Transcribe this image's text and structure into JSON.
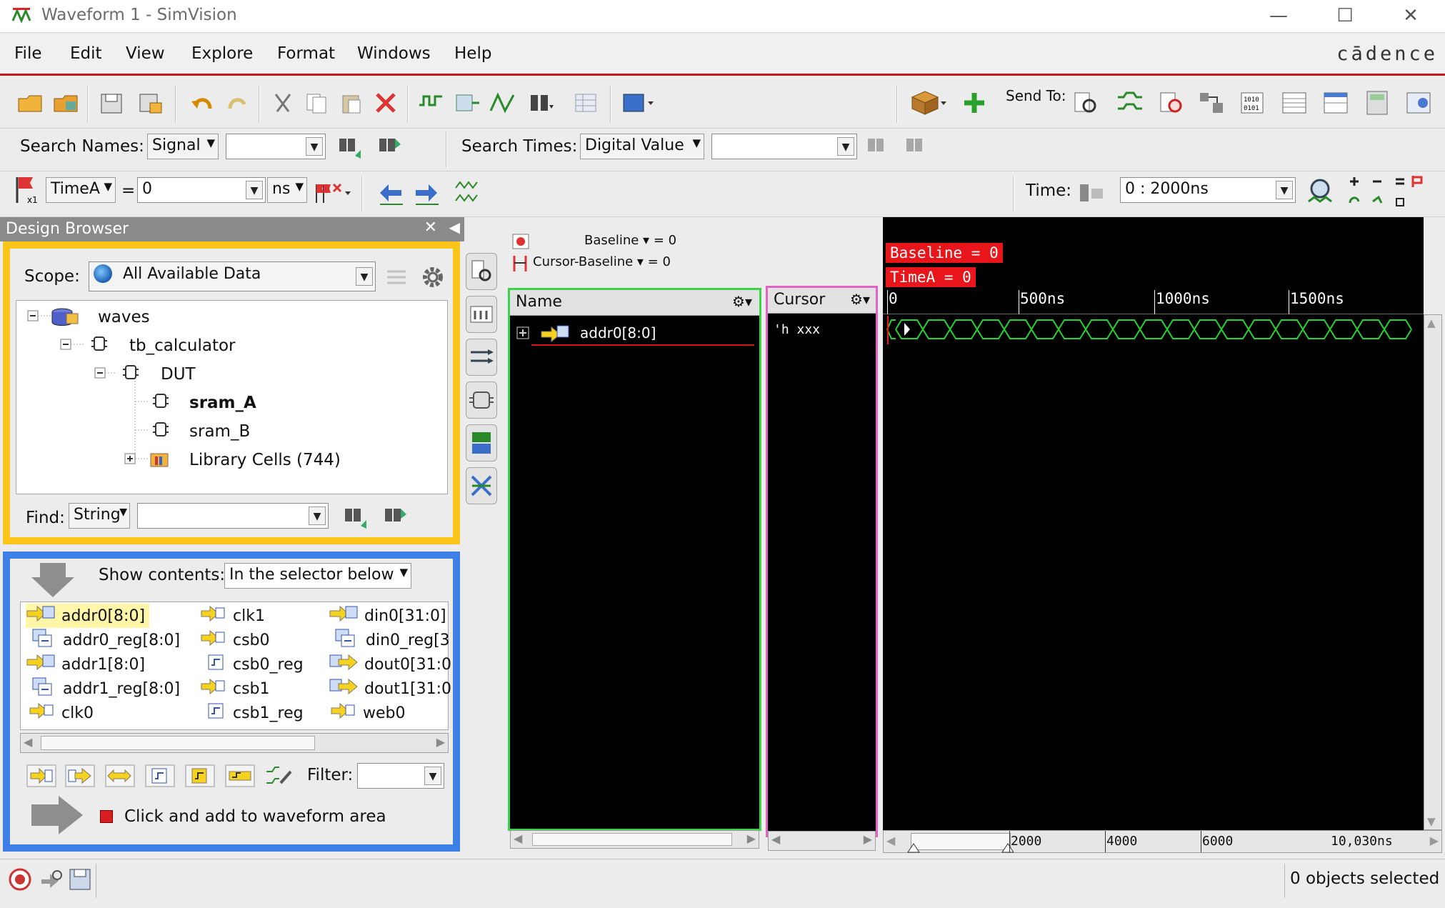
{
  "window": {
    "title": "Waveform 1 - SimVision",
    "minimize": "—",
    "maximize": "☐",
    "close": "✕"
  },
  "menu": {
    "items": [
      "File",
      "Edit",
      "View",
      "Explore",
      "Format",
      "Windows",
      "Help"
    ],
    "brand": "cādence"
  },
  "toolbar1": {
    "send_to_label": "Send To:"
  },
  "toolbar2": {
    "search_names_label": "Search Names:",
    "search_names_type": "Signal",
    "search_names_value": "",
    "search_times_label": "Search Times:",
    "search_times_type": "Digital Value",
    "search_times_value": ""
  },
  "toolbar3": {
    "time_marker": "TimeA",
    "equals": "=",
    "time_value": "0",
    "time_unit": "ns",
    "time_label": "Time:",
    "time_range": "0 : 2000ns"
  },
  "design_browser": {
    "title": "Design Browser",
    "scope_label": "Scope:",
    "scope_value": "All Available Data",
    "tree": [
      {
        "label": "waves",
        "bold": false
      },
      {
        "label": "tb_calculator",
        "bold": false
      },
      {
        "label": "DUT",
        "bold": false
      },
      {
        "label": "sram_A",
        "bold": true
      },
      {
        "label": "sram_B",
        "bold": false
      },
      {
        "label": "Library Cells (744)",
        "bold": false
      }
    ],
    "find_label": "Find:",
    "find_type": "String",
    "find_value": ""
  },
  "contents": {
    "show_label": "Show contents:",
    "show_value": "In the selector below",
    "signals_col1": [
      "addr0[8:0]",
      "addr0_reg[8:0]",
      "addr1[8:0]",
      "addr1_reg[8:0]",
      "clk0"
    ],
    "signals_col2": [
      "clk1",
      "csb0",
      "csb0_reg",
      "csb1",
      "csb1_reg"
    ],
    "signals_col3": [
      "din0[31:0]",
      "din0_reg[3",
      "dout0[31:0",
      "dout1[31:0",
      "web0"
    ],
    "filter_label": "Filter:",
    "filter_value": "",
    "hint": "Click and add to waveform area"
  },
  "waveform": {
    "baseline_label": "Baseline",
    "baseline_value": "= 0",
    "cursor_baseline_label": "Cursor-Baseline",
    "cursor_baseline_value": "= 0",
    "name_header": "Name",
    "cursor_header": "Cursor",
    "signal_name": "addr0[8:0]",
    "cursor_value": "'h xxx",
    "baseline_tag": "Baseline = 0",
    "timea_tag": "TimeA = 0",
    "ruler": [
      "0",
      "500ns",
      "1000ns",
      "1500ns"
    ],
    "bottom_ruler": [
      "2000",
      "4000",
      "6000",
      "10,030ns"
    ]
  },
  "status": {
    "selection": "0 objects selected"
  },
  "colors": {
    "accent_red": "#c8171f",
    "name_border": "#3cd24a",
    "cursor_border": "#e063c6",
    "browser_border": "#fbc51a",
    "contents_border": "#3f7fe8",
    "wave_green": "#22d632"
  }
}
